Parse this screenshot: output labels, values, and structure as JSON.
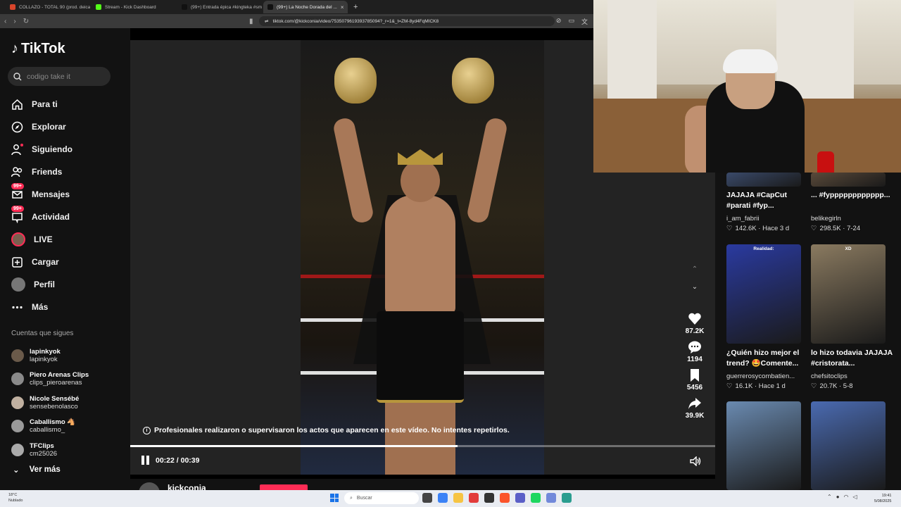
{
  "browser": {
    "tabs": [
      {
        "label": "COLLAZO - TOTAL 90 (prod. deica) [V",
        "color": "#d9452b",
        "active": false
      },
      {
        "label": "Stream - Kick Dashboard",
        "color": "#53fc18",
        "active": false
      },
      {
        "label": "(99+) Entrada épica #kingteka #sma...",
        "color": "#111111",
        "active": false
      },
      {
        "label": "(99+) La Noche Dorada del ...",
        "color": "#111111",
        "active": true
      }
    ],
    "close_glyph": "×",
    "new_tab_glyph": "+",
    "url": "tiktok.com/@kickconia/video/7535079619393785094?_r=1&_t=ZM-8yd4FqMICK8"
  },
  "tiktok": {
    "brand": "TikTok",
    "search_placeholder": "codigo take it",
    "menu": [
      {
        "label": "Para ti",
        "icon": "home-icon"
      },
      {
        "label": "Explorar",
        "icon": "compass-icon"
      },
      {
        "label": "Siguiendo",
        "icon": "following-icon"
      },
      {
        "label": "Friends",
        "icon": "friends-icon"
      },
      {
        "label": "Mensajes",
        "icon": "messages-icon",
        "badge": "99+"
      },
      {
        "label": "Actividad",
        "icon": "activity-icon",
        "badge": "99+"
      },
      {
        "label": "LIVE",
        "icon": "live-icon"
      },
      {
        "label": "Cargar",
        "icon": "upload-icon"
      },
      {
        "label": "Perfil",
        "icon": "profile-icon"
      },
      {
        "label": "Más",
        "icon": "more-icon"
      }
    ],
    "following_title": "Cuentas que sigues",
    "following": [
      {
        "name": "lapinkyok",
        "handle": "lapinkyok",
        "color": "#6a5a4a"
      },
      {
        "name": "Piero Arenas Clips",
        "handle": "clips_pieroarenas",
        "color": "#8a8a8a"
      },
      {
        "name": "Nicole Sensébé",
        "handle": "sensebenolasco",
        "color": "#c0b0a0"
      },
      {
        "name": "Caballismo 🐴",
        "handle": "caballismo_",
        "color": "#9a9a9a"
      },
      {
        "name": "TFClips",
        "handle": "cm25026",
        "color": "#aaaaaa"
      }
    ],
    "ver_mas": "Ver más"
  },
  "video": {
    "notice": "Profesionales realizaron o supervisaron los actos que aparecen en este vídeo. No intentes repetirlos.",
    "time": "00:22 / 00:39",
    "progress": 0.56,
    "likes": "87.2K",
    "comments": "1194",
    "saves": "5456",
    "shares": "39.9K",
    "author": "kickconia"
  },
  "recommended": [
    {
      "title": "JAJAJA #CapCut #parati #fyp...",
      "user": "i_am_fabrii",
      "stats": "142.6K · Hace 3 d",
      "thumb_color": "#3a4a6a"
    },
    {
      "title": "... #fypppppppppppp...",
      "user": "belikegirln",
      "stats": "298.5K · 7-24",
      "thumb_color": "#5a4a3a"
    },
    {
      "title": "¿Quién hizo mejor el trend? 🤩Comente...",
      "user": "guerrerosycombatien...",
      "stats": "16.1K · Hace 1 d",
      "thumb_color": "#2a3aa0",
      "label": "Realidad:"
    },
    {
      "title": "lo hizo todavia JAJAJA #cristorata...",
      "user": "chefsitoclips",
      "stats": "20.7K · 5-8",
      "thumb_color": "#8a7a60",
      "label": "XD"
    },
    {
      "title": "",
      "user": "",
      "stats": "",
      "thumb_color": "#6a8ab0"
    },
    {
      "title": "",
      "user": "",
      "stats": "",
      "thumb_color": "#4a6ab0"
    }
  ],
  "taskbar": {
    "weather_temp": "18°C",
    "weather_desc": "Nublado",
    "search_placeholder": "Buscar",
    "time": "19:41",
    "date": "5/08/2025"
  },
  "colors": {
    "accent": "#fe2c55",
    "sidebar_bg": "#121212",
    "video_bg": "#232323"
  }
}
